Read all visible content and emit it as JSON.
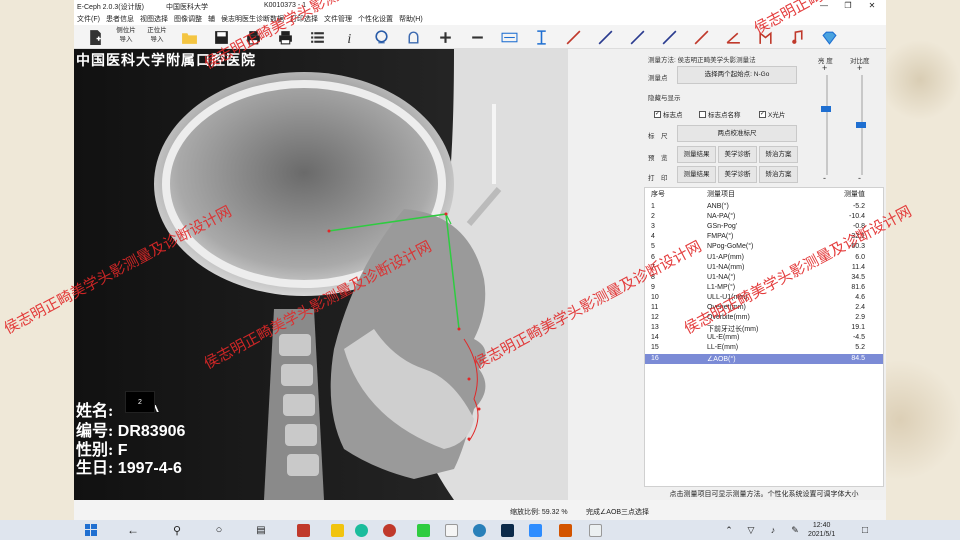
{
  "window": {
    "title": "E-Ceph 2.0.3(设计版)",
    "org": "中国医科大学",
    "doc": "K0010373 - 1"
  },
  "menu": [
    "文件(F)",
    "患者信息",
    "视图选择",
    "图像调整",
    "辅",
    "侯志明医生诊断数据",
    "打印选择",
    "文件管理",
    "个性化设置",
    "帮助(H)"
  ],
  "toolbar": {
    "lateral_label_1": "侧位片",
    "lateral_label_2": "导入",
    "frontal_label_1": "正位片",
    "frontal_label_2": "导入"
  },
  "xray": {
    "header": "中国医科大学附属口腔医院",
    "name_label": "姓名:",
    "name_value": "^",
    "badge": "2",
    "id_label": "编号:",
    "id_value": "DR83906",
    "sex_label": "性别:",
    "sex_value": "F",
    "dob_label": "生日:",
    "dob_value": "1997-4-6"
  },
  "panel": {
    "method_label": "测量方法:",
    "method_value": "侯志明正畸美学头影测量法",
    "measure_label": "测量点",
    "measure_button": "选择两个起始点: N-Go",
    "hide_show": "隐藏与显示",
    "chk_point": "标志点",
    "chk_point_checked": true,
    "chk_name": "标志点名称",
    "chk_name_checked": false,
    "chk_xray": "X光片",
    "chk_xray_checked": true,
    "ruler_label": "标　尺",
    "ruler_button": "两点校准标尺",
    "preview_label": "预　览",
    "print_label": "打　印",
    "btn_results": "测量结果",
    "btn_aesthetic": "美学诊断",
    "btn_plan": "矫治方案",
    "slider1_label": "亮 度",
    "slider2_label": "对比度",
    "slider1_level": 0.33,
    "slider2_level": 0.5
  },
  "table": {
    "headers": [
      "序号",
      "测量项目",
      "测量值"
    ],
    "rows": [
      [
        "1",
        "ANB(°)",
        "-5.2"
      ],
      [
        "2",
        "NA-PA(°)",
        "-10.4"
      ],
      [
        "3",
        "GSn-Pog'",
        "-0.8"
      ],
      [
        "4",
        "FMPA(°)",
        "32.1"
      ],
      [
        "5",
        "NPog-GoMe(°)",
        "-60.3"
      ],
      [
        "6",
        "U1-AP(mm)",
        "6.0"
      ],
      [
        "7",
        "U1-NA(mm)",
        "11.4"
      ],
      [
        "8",
        "U1-NA(°)",
        "34.5"
      ],
      [
        "9",
        "L1-MP(°)",
        "81.6"
      ],
      [
        "10",
        "ULL-U1(mm)",
        "4.6"
      ],
      [
        "11",
        "Overjet(mm)",
        "2.4"
      ],
      [
        "12",
        "Overbite(mm)",
        "2.9"
      ],
      [
        "13",
        "下前牙过长(mm)",
        "19.1"
      ],
      [
        "14",
        "UL-E(mm)",
        "-4.5"
      ],
      [
        "15",
        "LL-E(mm)",
        "5.2"
      ],
      [
        "16",
        "∠AOB(°)",
        "84.5"
      ]
    ],
    "selected_index": 15
  },
  "hint": "点击测量项目可显示测量方法。个性化系统设置可调字体大小",
  "status": {
    "zoom": "缩放比例: 59.32 %",
    "message": "完成∠AOB三点选择"
  },
  "watermark": "侯志明正畸美学头影测量及诊断设计网",
  "taskbar": {
    "time": "12:40",
    "date": "2021/5/1"
  },
  "colors": {
    "accent": "#1f6fd1",
    "selection": "#7b8bd6",
    "watermark": "#e12828",
    "trace": "#2ecc40"
  }
}
